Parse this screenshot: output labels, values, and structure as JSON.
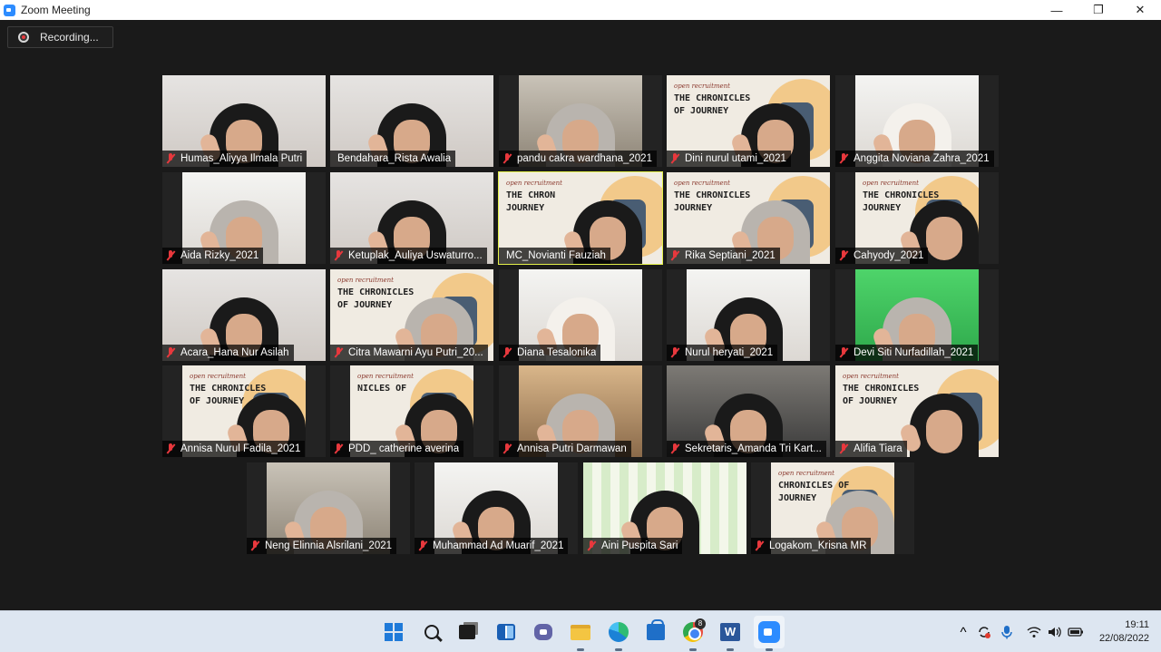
{
  "window": {
    "title": "Zoom Meeting",
    "minimize_glyph": "—",
    "maximize_glyph": "❐",
    "close_glyph": "✕"
  },
  "recording": {
    "label": "Recording..."
  },
  "participants": [
    {
      "name": "Humas_Aliyya Ilmala Putri",
      "video": "light",
      "muted": true
    },
    {
      "name": "Bendahara_Rista Awalia",
      "video": "light",
      "muted": false
    },
    {
      "name": "pandu cakra wardhana_2021",
      "video": "room",
      "muted": true
    },
    {
      "name": "Dini nurul utami_2021",
      "video": "poster",
      "muted": true
    },
    {
      "name": "Anggita Noviana Zahra_2021",
      "video": "white",
      "muted": true
    },
    {
      "name": "Aida Rizky_2021",
      "video": "white",
      "muted": true
    },
    {
      "name": "Ketuplak_Auliya Uswaturro...",
      "video": "light",
      "muted": true
    },
    {
      "name": "MC_Novianti Fauziah",
      "video": "poster",
      "muted": false,
      "active": true
    },
    {
      "name": "Rika Septiani_2021",
      "video": "poster",
      "muted": true
    },
    {
      "name": "Cahyody_2021",
      "video": "poster",
      "muted": true
    },
    {
      "name": "Acara_Hana Nur  Asilah",
      "video": "light",
      "muted": true
    },
    {
      "name": "Citra Mawarni Ayu Putri_20...",
      "video": "poster",
      "muted": true
    },
    {
      "name": "Diana Tesalonika",
      "video": "white",
      "muted": true
    },
    {
      "name": "Nurul heryati_2021",
      "video": "white",
      "muted": true
    },
    {
      "name": "Devi Siti Nurfadillah_2021",
      "video": "green",
      "muted": true
    },
    {
      "name": "Annisa Nurul Fadila_2021",
      "video": "poster",
      "muted": true
    },
    {
      "name": "PDD_ catherine averina",
      "video": "poster",
      "muted": true
    },
    {
      "name": "Annisa Putri Darmawan",
      "video": "warm",
      "muted": true
    },
    {
      "name": "Sekretaris_Amanda Tri Kart...",
      "video": "dark",
      "muted": true
    },
    {
      "name": "Alifia Tiara",
      "video": "poster",
      "muted": true
    },
    {
      "name": "Neng Elinnia Alsrilani_2021",
      "video": "room",
      "muted": true
    },
    {
      "name": "Muhammad Ad Muarif_2021",
      "video": "white",
      "muted": true
    },
    {
      "name": "Aini Puspita Sari",
      "video": "pattern",
      "muted": true
    },
    {
      "name": "Logakom_Krisna MR",
      "video": "poster",
      "muted": true
    }
  ],
  "poster": {
    "small": "open recruitment",
    "big_full": "THE CHRONICLES OF JOURNEY",
    "big_partial_1": "THE CHRON JOURNEY",
    "big_partial_2": "CHRONICLES OF JOURNEY",
    "big_partial_3": "NICLES OF",
    "big_partial_4": "THE CHRONICLES JOURNEY"
  },
  "taskbar": {
    "chrome_badge": "8",
    "word_letter": "W",
    "tray_chevron": "^"
  },
  "clock": {
    "time": "19:11",
    "date": "22/08/2022"
  }
}
